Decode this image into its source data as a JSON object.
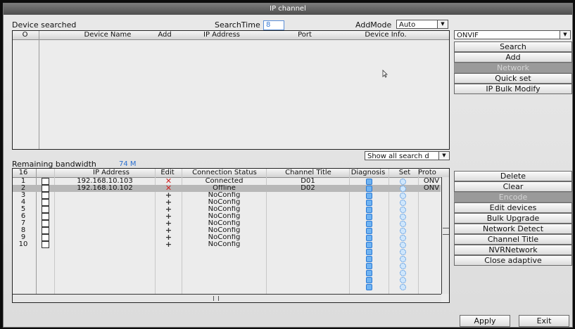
{
  "window": {
    "title": "IP channel"
  },
  "search_area": {
    "section_label": "Device searched",
    "search_time_label": "SearchTime",
    "search_time_value": "8",
    "add_mode_label": "AddMode",
    "add_mode_value": "Auto",
    "protocol_value": "ONVIF",
    "columns": [
      "O",
      "Device Name",
      "Add",
      "IP Address",
      "Port",
      "Device Info."
    ],
    "filter_value": "Show all search d"
  },
  "search_buttons": [
    "Search",
    "Add",
    "Network",
    "Quick set",
    "IP Bulk Modify"
  ],
  "bandwidth": {
    "label": "Remaining bandwidth",
    "value": "74 M"
  },
  "channels": {
    "count_header": "16",
    "columns": [
      "IP Address",
      "Edit",
      "Connection Status",
      "Channel Title",
      "Diagnosis",
      "Set",
      "Proto"
    ],
    "rows": [
      {
        "num": "1",
        "ip": "192.168.10.103",
        "edit": "x",
        "status": "Connected",
        "title": "D01",
        "proto": "ONV"
      },
      {
        "num": "2",
        "ip": "192.168.10.102",
        "edit": "x",
        "status": "Offline",
        "title": "D02",
        "proto": "ONV"
      },
      {
        "num": "3",
        "ip": "",
        "edit": "+",
        "status": "NoConfig",
        "title": "",
        "proto": ""
      },
      {
        "num": "4",
        "ip": "",
        "edit": "+",
        "status": "NoConfig",
        "title": "",
        "proto": ""
      },
      {
        "num": "5",
        "ip": "",
        "edit": "+",
        "status": "NoConfig",
        "title": "",
        "proto": ""
      },
      {
        "num": "6",
        "ip": "",
        "edit": "+",
        "status": "NoConfig",
        "title": "",
        "proto": ""
      },
      {
        "num": "7",
        "ip": "",
        "edit": "+",
        "status": "NoConfig",
        "title": "",
        "proto": ""
      },
      {
        "num": "8",
        "ip": "",
        "edit": "+",
        "status": "NoConfig",
        "title": "",
        "proto": ""
      },
      {
        "num": "9",
        "ip": "",
        "edit": "+",
        "status": "NoConfig",
        "title": "",
        "proto": ""
      },
      {
        "num": "10",
        "ip": "",
        "edit": "+",
        "status": "NoConfig",
        "title": "",
        "proto": ""
      }
    ]
  },
  "channel_buttons": [
    "Delete",
    "Clear",
    "Encode",
    "Edit devices",
    "Bulk Upgrade",
    "Network Detect",
    "Channel Title",
    "NVRNetwork",
    "Close adaptive"
  ],
  "footer": {
    "apply": "Apply",
    "exit": "Exit"
  }
}
